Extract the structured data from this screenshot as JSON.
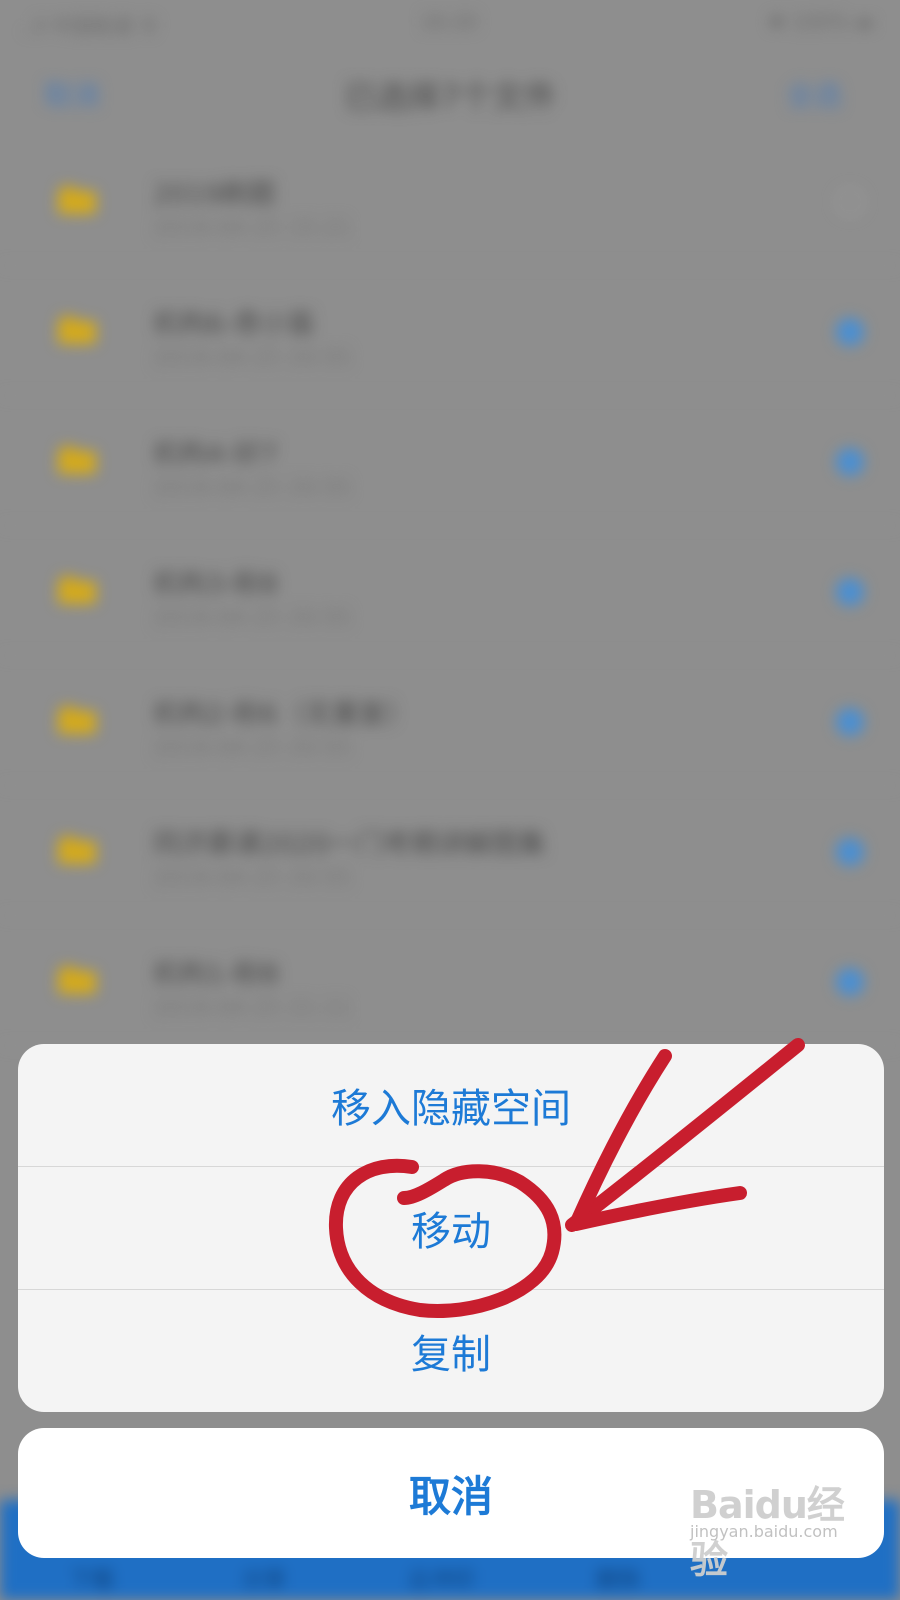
{
  "status_bar": {
    "carrier": "..ll 中国联通 令",
    "time": "16:20",
    "battery": "✱ 100% ▬"
  },
  "nav": {
    "left_label": "取消",
    "title": "已选择7个文件",
    "right_label": "全选"
  },
  "files": [
    {
      "name": "2019刷题",
      "date": "2019-04-25 15:21",
      "checked": false
    },
    {
      "name": "机构6-奇小笛",
      "date": "2019-04-25 20:55",
      "checked": true
    },
    {
      "name": "机构4-好7",
      "date": "2019-04-25 20:55",
      "checked": true
    },
    {
      "name": "机构3-粉8",
      "date": "2019-04-25 20:55",
      "checked": true
    },
    {
      "name": "机构2-粉6（无重复）",
      "date": "2019-04-25 20:55",
      "checked": true
    },
    {
      "name": "同济慕课2020一门考期讲解图集",
      "date": "2019-04-25 20:55",
      "checked": true
    },
    {
      "name": "机构1-粉B",
      "date": "2019-04-25 21:11",
      "checked": true
    }
  ],
  "tab_bar": {
    "items": [
      "下载",
      "分享",
      "云冲印",
      "删除"
    ]
  },
  "action_sheet": {
    "items": [
      "移入隐藏空间",
      "移动",
      "复制"
    ],
    "cancel": "取消"
  },
  "watermark": {
    "brand": "Baidu经验",
    "url": "jingyan.baidu.com"
  },
  "colors": {
    "accent": "#1d7ad6",
    "annotation": "#c81e2e",
    "folder": "#d4aa1c",
    "tab_bar": "#1f6fc4"
  }
}
